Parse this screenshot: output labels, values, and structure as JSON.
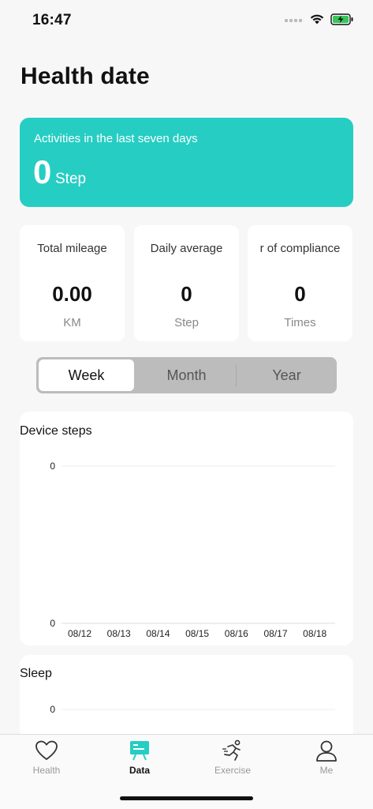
{
  "status_bar": {
    "time": "16:47"
  },
  "header": {
    "title": "Health date"
  },
  "summary": {
    "caption": "Activities in the last seven days",
    "value": "0",
    "unit": "Step",
    "bg_color": "#26cdc3"
  },
  "stats": [
    {
      "label": "Total mileage",
      "value": "0.00",
      "unit": "KM"
    },
    {
      "label": "Daily average",
      "value": "0",
      "unit": "Step"
    },
    {
      "label": "r of compliance",
      "value": "0",
      "unit": "Times"
    }
  ],
  "period_tabs": [
    {
      "label": "Week",
      "selected": true
    },
    {
      "label": "Month",
      "selected": false
    },
    {
      "label": "Year",
      "selected": false
    }
  ],
  "chart_data": [
    {
      "type": "bar",
      "title": "Device steps",
      "categories": [
        "08/12",
        "08/13",
        "08/14",
        "08/15",
        "08/16",
        "08/17",
        "08/18"
      ],
      "values": [
        0,
        0,
        0,
        0,
        0,
        0,
        0
      ],
      "ytick_labels": [
        "0",
        "0"
      ],
      "ylim": [
        0,
        0
      ],
      "grid": true
    },
    {
      "type": "bar",
      "title": "Sleep",
      "ytick_labels": [
        "0"
      ]
    }
  ],
  "tab_bar": {
    "items": [
      {
        "label": "Health",
        "icon": "heart-icon",
        "active": false
      },
      {
        "label": "Data",
        "icon": "data-board-icon",
        "active": true
      },
      {
        "label": "Exercise",
        "icon": "running-icon",
        "active": false
      },
      {
        "label": "Me",
        "icon": "person-icon",
        "active": false
      }
    ],
    "active_color": "#26cdc3"
  }
}
